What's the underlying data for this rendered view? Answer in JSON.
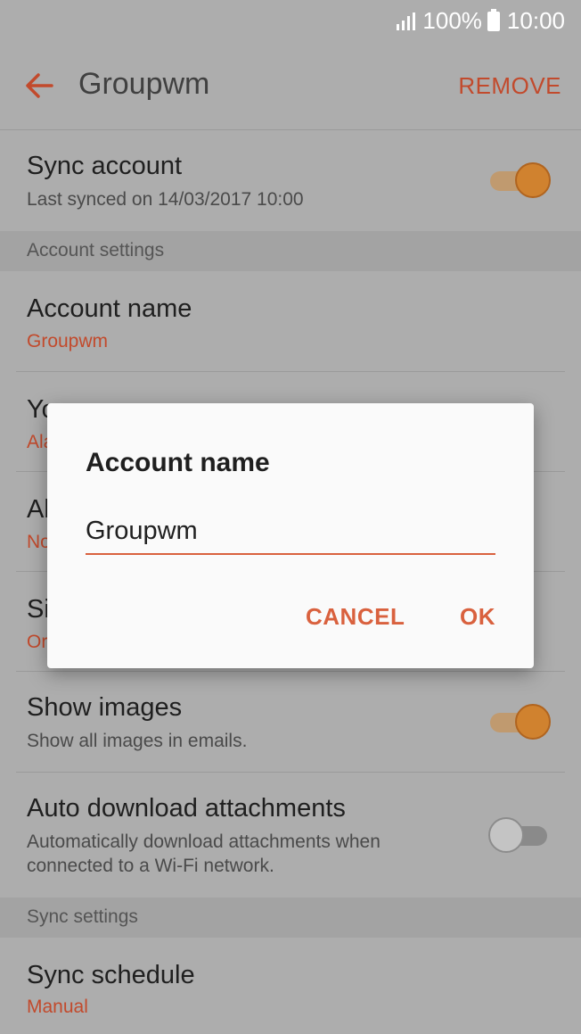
{
  "status": {
    "battery_percent": "100%",
    "time": "10:00"
  },
  "appbar": {
    "title": "Groupwm",
    "remove_label": "REMOVE"
  },
  "sync_account": {
    "title": "Sync account",
    "subtitle": "Last synced on 14/03/2017  10:00",
    "enabled": true
  },
  "sections": {
    "account_settings": "Account settings",
    "sync_settings": "Sync settings"
  },
  "account_name_row": {
    "title": "Account name",
    "value": "Groupwm"
  },
  "partial_rows": [
    {
      "title_visible": "Yo",
      "sub_visible": "Ala"
    },
    {
      "title_visible": "Al",
      "sub_visible": "No"
    },
    {
      "title_visible": "Si",
      "sub_visible": "Or"
    }
  ],
  "show_images": {
    "title": "Show images",
    "subtitle": "Show all images in emails.",
    "enabled": true
  },
  "auto_download": {
    "title": "Auto download attachments",
    "subtitle_line1": "Automatically download attachments when",
    "subtitle_line2": "connected to a Wi-Fi network.",
    "enabled": false
  },
  "sync_schedule": {
    "title": "Sync schedule",
    "value": "Manual"
  },
  "dialog": {
    "title": "Account name",
    "input_value": "Groupwm",
    "cancel_label": "CANCEL",
    "ok_label": "OK"
  },
  "colors": {
    "accent": "#d9613e",
    "toggle_on": "#d0822f",
    "scrim_bg": "#adadad"
  },
  "icons": {
    "back": "arrow-left-icon",
    "signal": "signal-icon",
    "battery": "battery-icon"
  }
}
